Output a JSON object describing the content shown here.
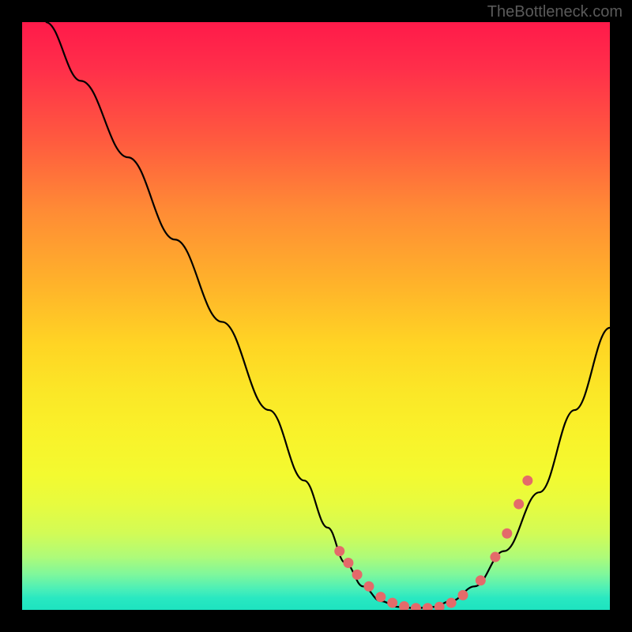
{
  "watermark": "TheBottleneck.com",
  "chart_data": {
    "type": "line",
    "title": "",
    "xlabel": "",
    "ylabel": "",
    "xlim": [
      0,
      100
    ],
    "ylim": [
      0,
      100
    ],
    "series": [
      {
        "name": "curve",
        "x": [
          4,
          10,
          18,
          26,
          34,
          42,
          48,
          52,
          55,
          58,
          61,
          64,
          67,
          70,
          73,
          77,
          82,
          88,
          94,
          100
        ],
        "y": [
          100,
          90,
          77,
          63,
          49,
          34,
          22,
          14,
          8,
          4,
          1.5,
          0.5,
          0.3,
          0.5,
          1.5,
          4,
          10,
          20,
          34,
          48
        ]
      }
    ],
    "markers": {
      "name": "highlighted-points",
      "color": "#e46a6a",
      "x": [
        54,
        55.5,
        57,
        59,
        61,
        63,
        65,
        67,
        69,
        71,
        73,
        75,
        78,
        80.5,
        82.5,
        84.5,
        86
      ],
      "y": [
        10,
        8,
        6,
        4,
        2.2,
        1.2,
        0.6,
        0.3,
        0.3,
        0.5,
        1.2,
        2.5,
        5,
        9,
        13,
        18,
        22
      ]
    },
    "background": "vertical-gradient-rainbow"
  }
}
